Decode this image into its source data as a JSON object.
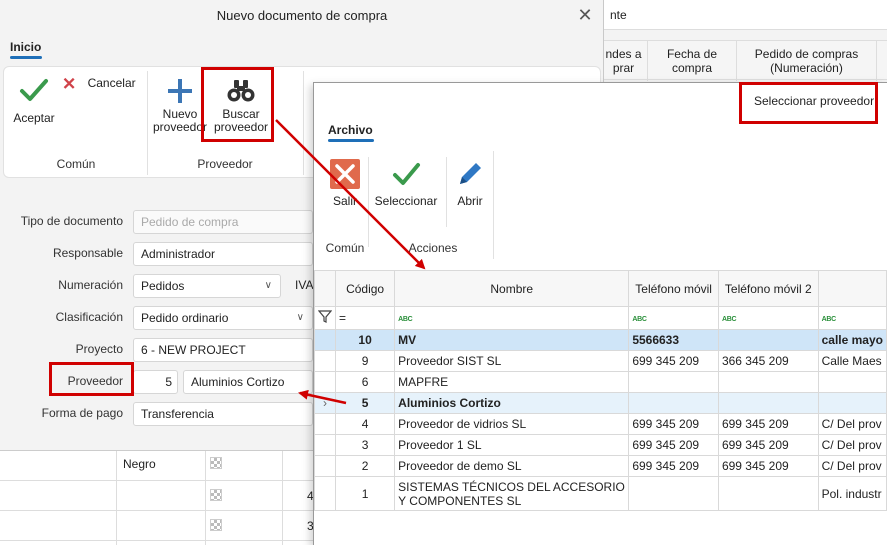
{
  "background": {
    "top_text": "nte",
    "columns": [
      {
        "label": "ndes a\nprar"
      },
      {
        "label": "Fecha de\ncompra"
      },
      {
        "label": "Pedido de compras\n(Numeración)"
      }
    ],
    "bottom_col": "Negro",
    "digits": [
      "4",
      "3"
    ]
  },
  "dialog": {
    "title": "Nuevo documento de compra",
    "tab": "Inicio",
    "buttons": {
      "accept": "Aceptar",
      "cancel": "Cancelar",
      "new_supplier": "Nuevo\nproveedor",
      "search_supplier": "Buscar\nproveedor"
    },
    "groups": {
      "common": "Común",
      "supplier": "Proveedor"
    },
    "form": {
      "doc_type": {
        "label": "Tipo de documento",
        "value": "Pedido de compra"
      },
      "responsible": {
        "label": "Responsable",
        "value": "Administrador"
      },
      "numbering": {
        "label": "Numeración",
        "value": "Pedidos",
        "extra": "IVA"
      },
      "classification": {
        "label": "Clasificación",
        "value": "Pedido ordinario"
      },
      "project": {
        "label": "Proyecto",
        "value": "6  -  NEW PROJECT"
      },
      "supplier": {
        "label": "Proveedor",
        "code": "5",
        "name": "Aluminios Cortizo"
      },
      "payment": {
        "label": "Forma de pago",
        "value": "Transferencia"
      }
    }
  },
  "selector": {
    "title": "Seleccionar proveedor",
    "tab": "Archivo",
    "buttons": {
      "exit": "Salir",
      "select": "Seleccionar",
      "open": "Abrir"
    },
    "groups": {
      "common": "Común",
      "actions": "Acciones"
    },
    "columns": [
      "Código",
      "Nombre",
      "Teléfono móvil",
      "Teléfono móvil 2",
      ""
    ],
    "filter_op": "=",
    "rows": [
      {
        "code": "10",
        "name": "MV",
        "phone": "5566633",
        "phone2": "",
        "address": "calle mayo"
      },
      {
        "code": "9",
        "name": "Proveedor SIST SL",
        "phone": "699 345 209",
        "phone2": "366 345 209",
        "address": "Calle Maes"
      },
      {
        "code": "6",
        "name": "MAPFRE",
        "phone": "",
        "phone2": "",
        "address": ""
      },
      {
        "code": "5",
        "name": "Aluminios Cortizo",
        "phone": "",
        "phone2": "",
        "address": ""
      },
      {
        "code": "4",
        "name": "Proveedor de vidrios SL",
        "phone": "699 345 209",
        "phone2": "699 345 209",
        "address": "C/ Del prov"
      },
      {
        "code": "3",
        "name": "Proveedor 1 SL",
        "phone": "699 345 209",
        "phone2": "699 345 209",
        "address": "C/ Del prov"
      },
      {
        "code": "2",
        "name": "Proveedor de demo SL",
        "phone": "699 345 209",
        "phone2": "699 345 209",
        "address": "C/ Del prov"
      },
      {
        "code": "1",
        "name": "SISTEMAS TÉCNICOS DEL ACCESORIO Y COMPONENTES SL",
        "phone": "",
        "phone2": "",
        "address": "Pol. industr"
      }
    ]
  },
  "colors": {
    "accent": "#1e6fb8",
    "highlight": "#d00000",
    "selected_row": "#cfe5f8",
    "check_green": "#3a9a4c"
  }
}
